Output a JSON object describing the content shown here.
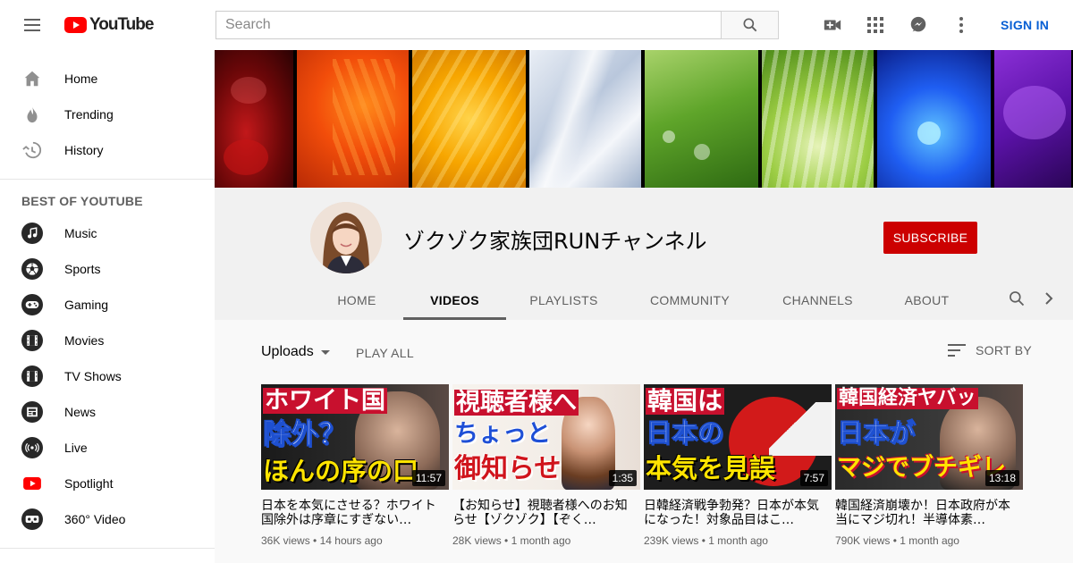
{
  "header": {
    "logo_text": "YouTube",
    "search_placeholder": "Search",
    "sign_in_label": "SIGN IN"
  },
  "sidebar": {
    "main_items": [
      {
        "label": "Home",
        "icon": "home-icon"
      },
      {
        "label": "Trending",
        "icon": "flame-icon"
      },
      {
        "label": "History",
        "icon": "history-icon"
      }
    ],
    "section_title": "BEST OF YOUTUBE",
    "best_items": [
      {
        "label": "Music",
        "icon": "music-icon"
      },
      {
        "label": "Sports",
        "icon": "sports-icon"
      },
      {
        "label": "Gaming",
        "icon": "gaming-icon"
      },
      {
        "label": "Movies",
        "icon": "movies-icon"
      },
      {
        "label": "TV Shows",
        "icon": "tv-icon"
      },
      {
        "label": "News",
        "icon": "news-icon"
      },
      {
        "label": "Live",
        "icon": "live-icon"
      },
      {
        "label": "Spotlight",
        "icon": "spotlight-icon"
      },
      {
        "label": "360° Video",
        "icon": "vr-icon"
      }
    ]
  },
  "channel": {
    "name": "ゾクゾク家族団RUNチャンネル",
    "subscribe_label": "SUBSCRIBE",
    "tabs": [
      "HOME",
      "VIDEOS",
      "PLAYLISTS",
      "COMMUNITY",
      "CHANNELS",
      "ABOUT"
    ],
    "active_tab": "VIDEOS"
  },
  "content": {
    "uploads_label": "Uploads",
    "play_all_label": "PLAY ALL",
    "sort_label": "SORT BY",
    "videos": [
      {
        "title": "日本を本気にさせる？ホワイト国除外は序章にすぎない…",
        "views": "36K views",
        "age": "14 hours ago",
        "duration": "11:57",
        "thumb_text": [
          "ホワイト国",
          "除外？",
          "ほんの序の口"
        ]
      },
      {
        "title": "【お知らせ】視聴者様へのお知らせ【ゾクゾク】【ぞく…",
        "views": "28K views",
        "age": "1 month ago",
        "duration": "1:35",
        "thumb_text": [
          "視聴者様へ",
          "ちょっと",
          "御知らせ"
        ]
      },
      {
        "title": "日韓経済戦争勃発？日本が本気になった！対象品目はこ…",
        "views": "239K views",
        "age": "1 month ago",
        "duration": "7:57",
        "thumb_text": [
          "韓国は",
          "日本の",
          "本気を見誤"
        ]
      },
      {
        "title": "韓国経済崩壊か！日本政府が本当にマジ切れ！半導体素…",
        "views": "790K views",
        "age": "1 month ago",
        "duration": "13:18",
        "thumb_text": [
          "韓国経済ヤバッ",
          "日本が",
          "マジでブチギレ"
        ]
      }
    ],
    "meta_separator": "•"
  },
  "colors": {
    "accent_red": "#cc0000",
    "link_blue": "#065fd4"
  }
}
